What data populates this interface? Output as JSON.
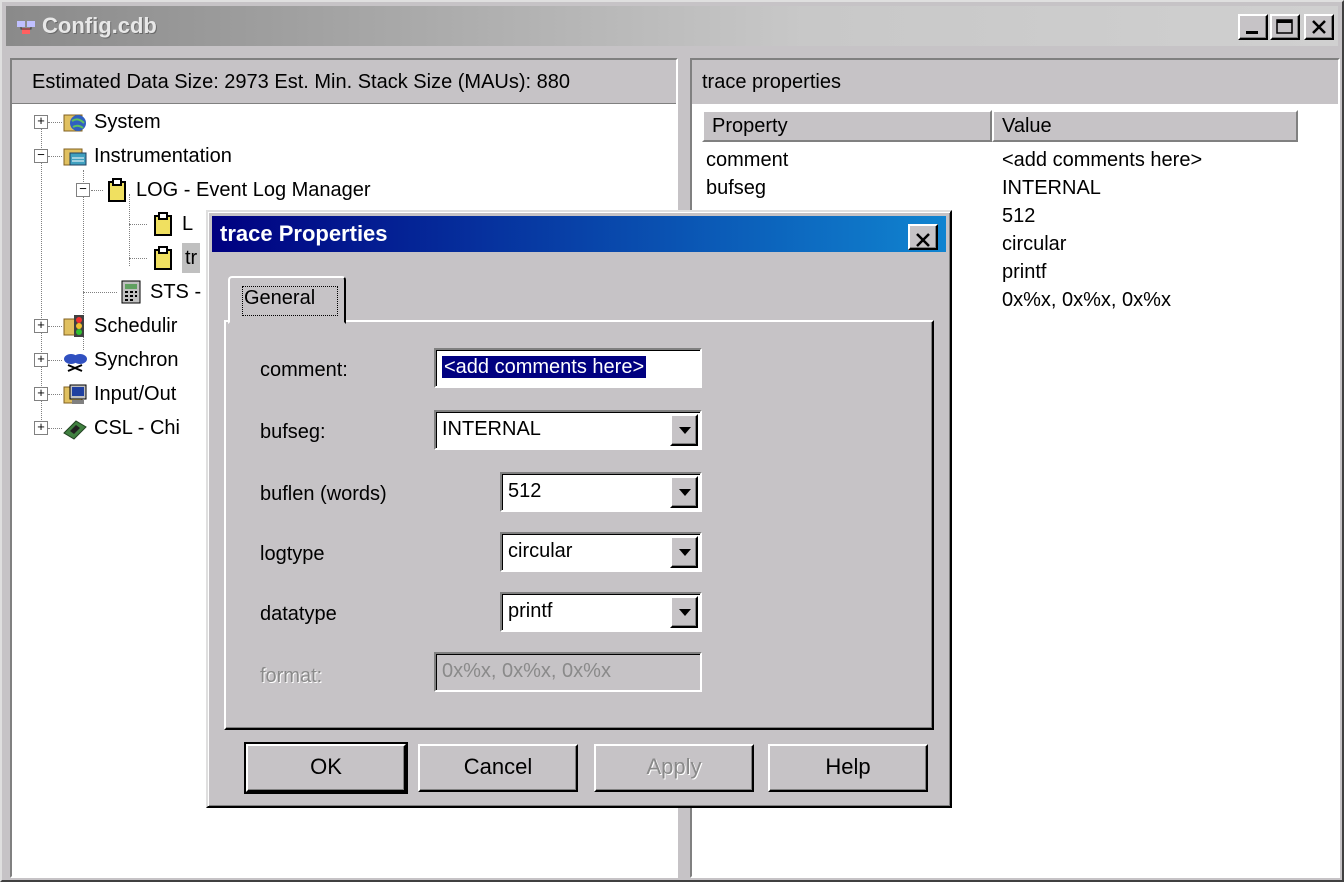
{
  "window": {
    "title": "Config.cdb"
  },
  "left_pane": {
    "header": "Estimated Data Size: 2973   Est. Min. Stack Size (MAUs): 880",
    "tree": [
      {
        "label": "System",
        "icon": "globe-icon",
        "expander": "+"
      },
      {
        "label": "Instrumentation",
        "icon": "instrumentation-icon",
        "expander": "−"
      },
      {
        "label": "LOG - Event Log Manager",
        "icon": "clipboard-icon",
        "expander": "−"
      },
      {
        "label": "L",
        "icon": "clipboard-icon"
      },
      {
        "label": "tr",
        "icon": "clipboard-icon"
      },
      {
        "label": "STS -",
        "icon": "calculator-icon"
      },
      {
        "label": "Schedulir",
        "icon": "traffic-light-icon",
        "expander": "+"
      },
      {
        "label": "Synchron",
        "icon": "sync-icon",
        "expander": "+"
      },
      {
        "label": "Input/Out",
        "icon": "monitor-icon",
        "expander": "+"
      },
      {
        "label": "CSL - Chi",
        "icon": "chip-icon",
        "expander": "+"
      }
    ]
  },
  "right_pane": {
    "header": "trace properties",
    "columns": [
      "Property",
      "Value"
    ],
    "rows": [
      {
        "property": "comment",
        "value": "<add comments here>"
      },
      {
        "property": "bufseg",
        "value": "INTERNAL"
      },
      {
        "property": "",
        "value": "512"
      },
      {
        "property": "",
        "value": "circular"
      },
      {
        "property": "",
        "value": "printf"
      },
      {
        "property": "",
        "value": "0x%x, 0x%x, 0x%x"
      }
    ]
  },
  "dialog": {
    "title": "trace Properties",
    "tab": "General",
    "fields": {
      "comment": {
        "label": "comment:",
        "value": "<add comments here>"
      },
      "bufseg": {
        "label": "bufseg:",
        "value": "INTERNAL"
      },
      "buflen": {
        "label": "buflen (words)",
        "value": "512"
      },
      "logtype": {
        "label": "logtype",
        "value": "circular"
      },
      "datatype": {
        "label": "datatype",
        "value": "printf"
      },
      "format": {
        "label": "format:",
        "value": "0x%x, 0x%x, 0x%x"
      }
    },
    "buttons": {
      "ok": "OK",
      "cancel": "Cancel",
      "apply": "Apply",
      "help": "Help"
    }
  }
}
